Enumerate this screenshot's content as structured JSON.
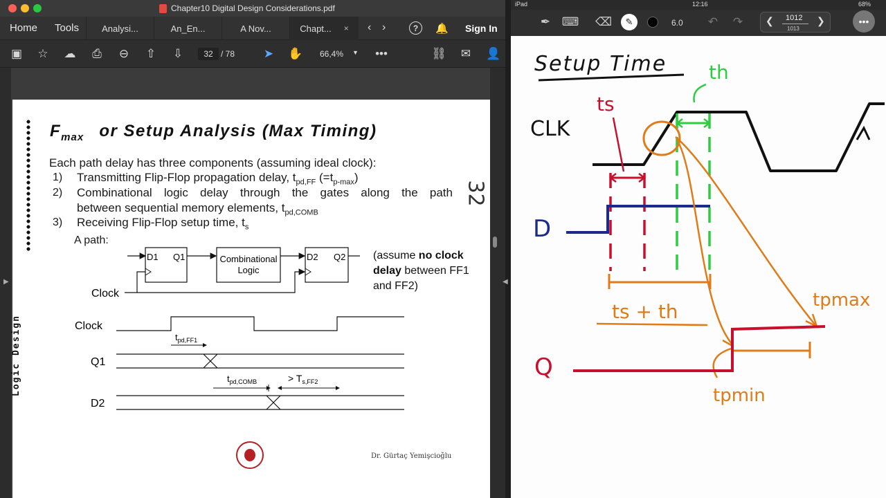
{
  "window": {
    "title": "Chapter10 Digital Design Considerations.pdf"
  },
  "tabbar": {
    "home": "Home",
    "tools": "Tools",
    "tabs": [
      {
        "label": "Analysi..."
      },
      {
        "label": "An_En..."
      },
      {
        "label": "A Nov..."
      },
      {
        "label": "Chapt..."
      }
    ],
    "close": "×",
    "help": "?",
    "sign_in": "Sign In"
  },
  "toolbar": {
    "current_page": "32",
    "page_of": "/ 78",
    "zoom": "66,4%"
  },
  "slide": {
    "title_main": "F",
    "title_sub": "max",
    "title_rest": "or Setup Analysis (Max Timing)",
    "intro": "Each path delay has three components (assuming ideal clock):",
    "items": [
      {
        "num": "1)",
        "text_a": "Transmitting Flip-Flop propagation delay, t",
        "sub_a": "pd,FF",
        "text_b": " (=t",
        "sub_b": "p-max",
        "text_c": ")"
      },
      {
        "num": "2)",
        "line1": "Combinational logic delay through the gates along the path",
        "line2": "between sequential memory elements, t",
        "sub": "pd,COMB"
      },
      {
        "num": "3)",
        "text": "Receiving Flip-Flop setup time, t",
        "sub": "s"
      }
    ],
    "path_label": "A path:",
    "diagram": {
      "ff1_d": "D1",
      "ff1_q": "Q1",
      "comb_line1": "Combinational",
      "comb_line2": "Logic",
      "ff2_d": "D2",
      "ff2_q": "Q2",
      "clock": "Clock"
    },
    "assume": {
      "pre": "(assume ",
      "bold1": "no clock",
      "bold2": "delay",
      "post": " between FF1 and FF2)"
    },
    "timing": {
      "clock": "Clock",
      "q1": "Q1",
      "d2": "D2",
      "tpd_ff1": "t",
      "tpd_ff1_sub": "pd,FF1",
      "tpd_comb": "t",
      "tpd_comb_sub": "pd,COMB",
      "ts_ff2": "> T",
      "ts_ff2_sub": "s,FF2"
    },
    "side_label": "Logic Design",
    "page_mark": "32",
    "author": "Dr. Gürtaç Yemişcioğlu"
  },
  "ipad": {
    "status_left": "iPad",
    "time": "12:16",
    "battery": "68%",
    "stroke_size": "6.0",
    "page_current": "1012",
    "page_total": "1013"
  },
  "notes": {
    "heading": "Setup Time",
    "th": "th",
    "ts": "ts",
    "clk": "CLK",
    "d": "D",
    "ts_th": "ts + th",
    "tpmax": "tpmax",
    "q": "Q",
    "tpmin": "tpmin"
  },
  "colors": {
    "ink_black": "#111111",
    "ink_red": "#c8102e",
    "ink_green": "#2ecc40",
    "ink_orange": "#e07b1a",
    "ink_blue": "#1c2a8c",
    "logo_red": "#b52025"
  }
}
